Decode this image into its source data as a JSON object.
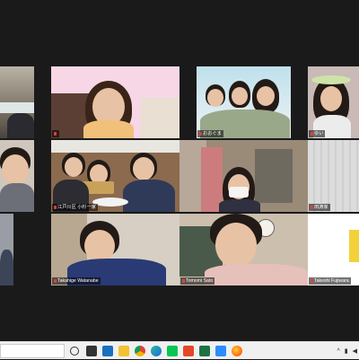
{
  "participants": [
    {
      "name": ""
    },
    {
      "name": ""
    },
    {
      "name": ""
    },
    {
      "name": "おおぐま"
    },
    {
      "name": "ゆい"
    },
    {
      "name": ""
    },
    {
      "name": "江戸川区 小杉一家"
    },
    {
      "name": ""
    },
    {
      "name": "田淵家"
    },
    {
      "name": "Takahige Watanabe"
    },
    {
      "name": "Tomomi Sato"
    },
    {
      "name": "Takeshi Fujiwara"
    }
  ],
  "colors": {
    "active_speaker": "#b8e86a",
    "background": "#1a1a1a",
    "mic_muted": "#e04040"
  },
  "taskbar": {
    "icons": [
      "task-view-icon",
      "file-explorer-icon",
      "store-icon",
      "mail-icon",
      "chrome-icon",
      "edge-icon",
      "line-icon",
      "office-icon",
      "excel-icon",
      "zoom-icon",
      "firefox-icon"
    ]
  }
}
